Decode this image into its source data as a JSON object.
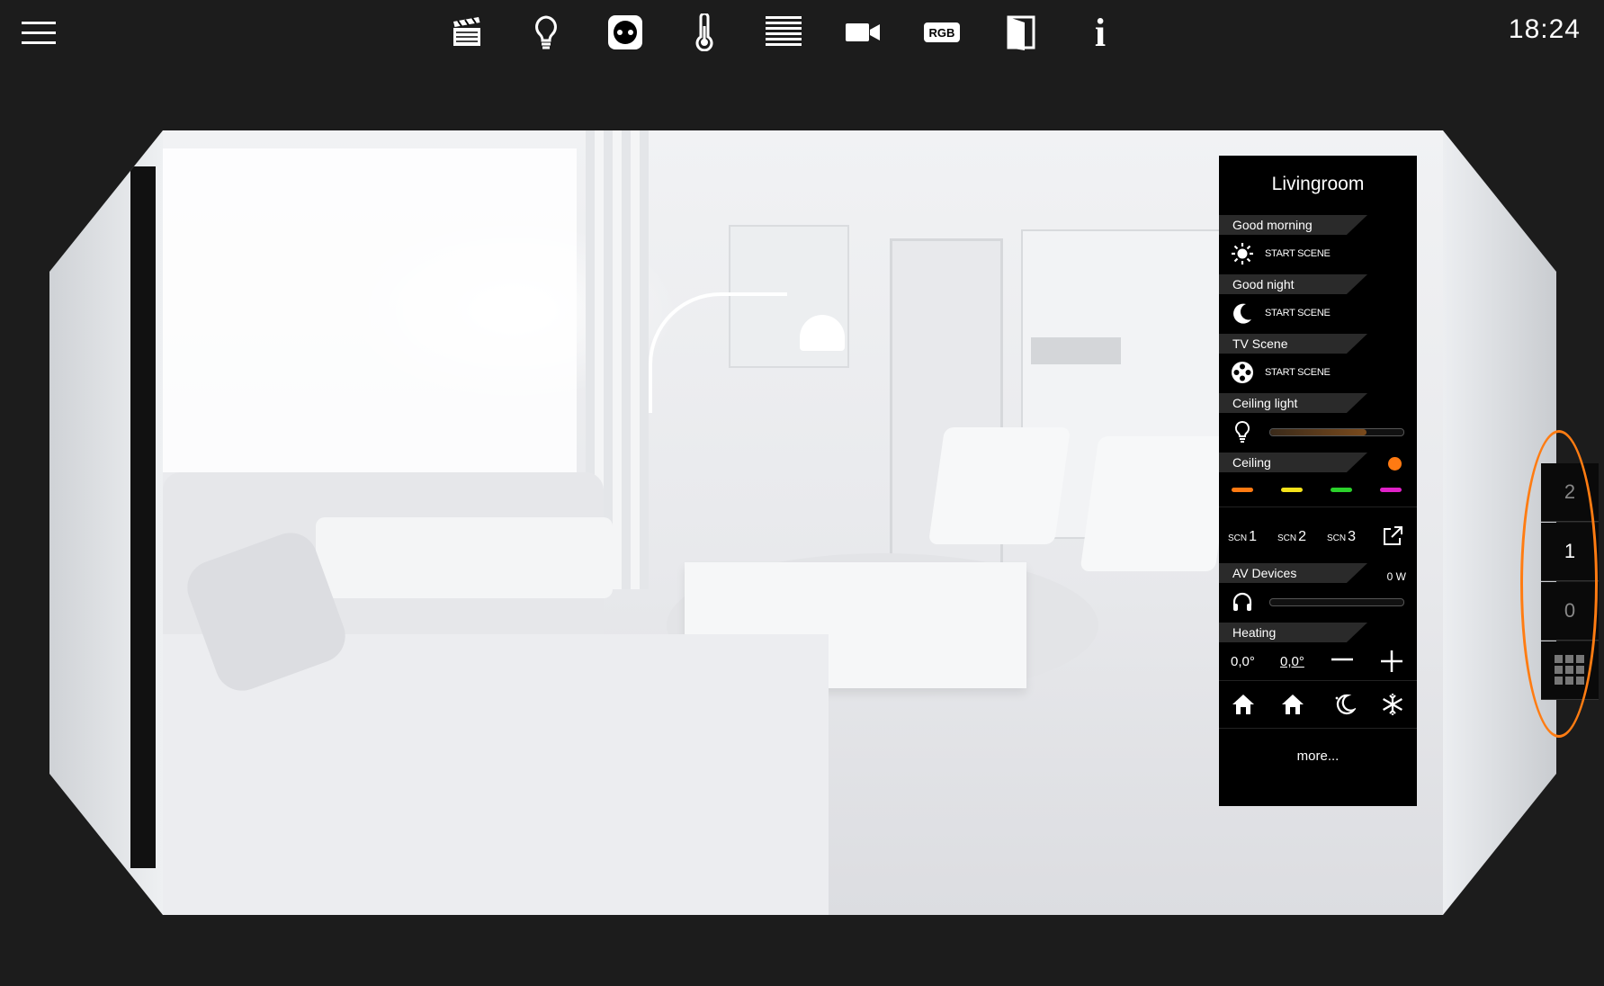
{
  "topbar": {
    "clock": "18:24",
    "icons": [
      "menu-icon",
      "scenes-clapper-icon",
      "light-bulb-icon",
      "socket-icon",
      "thermometer-icon",
      "blinds-icon",
      "camera-icon",
      "rgb-icon",
      "door-icon",
      "info-icon"
    ],
    "rgb_label": "RGB",
    "info_label": "i"
  },
  "panel": {
    "title": "Livingroom",
    "sections": {
      "good_morning": {
        "label": "Good morning",
        "action": "START SCENE"
      },
      "good_night": {
        "label": "Good night",
        "action": "START SCENE"
      },
      "tv_scene": {
        "label": "TV Scene",
        "action": "START SCENE"
      },
      "ceiling_light": {
        "label": "Ceiling light",
        "level": 0.72
      },
      "ceiling": {
        "label": "Ceiling",
        "indicator_color": "#ff7a12",
        "swatches": [
          "#ff7a12",
          "#f4e21a",
          "#2bd12b",
          "#e021c8"
        ]
      },
      "scenes": {
        "scn_prefix": "SCN",
        "scn1": "1",
        "scn2": "2",
        "scn3": "3"
      },
      "av_devices": {
        "label": "AV Devices",
        "power": "0 W",
        "level": 0.0
      },
      "heating": {
        "label": "Heating",
        "actual": "0,0°",
        "setpoint": "0,0°"
      }
    },
    "more": "more..."
  },
  "floors": {
    "items": [
      "2",
      "1",
      "0"
    ],
    "grid_icon": "grid-icon",
    "highlight_color": "#ff7c12"
  }
}
